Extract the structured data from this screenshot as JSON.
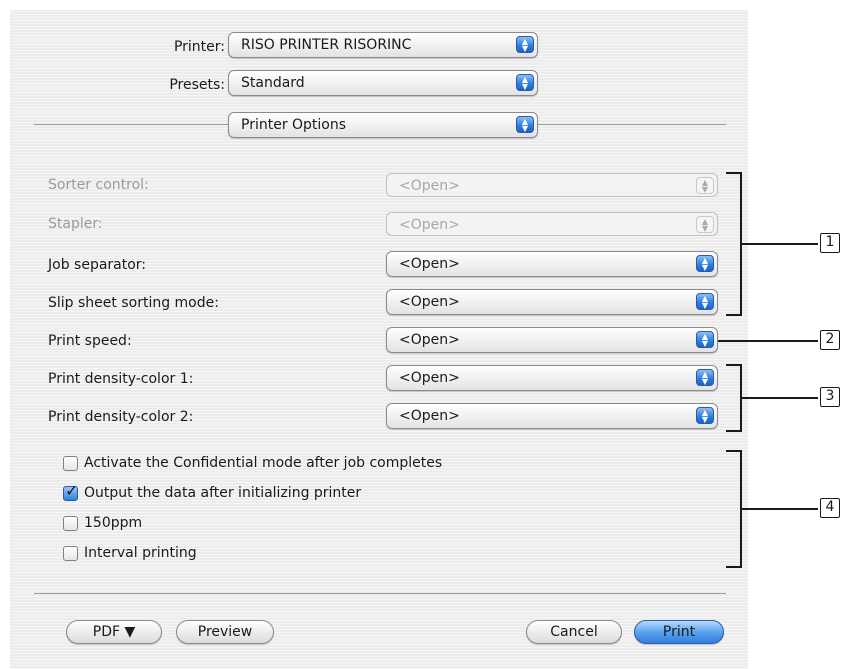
{
  "header": {
    "printer_label": "Printer:",
    "printer_value": "RISO PRINTER RISORINC",
    "presets_label": "Presets:",
    "presets_value": "Standard",
    "pane_value": "Printer Options"
  },
  "options": [
    {
      "label": "Sorter control:",
      "value": "<Open>",
      "enabled": false
    },
    {
      "label": "Stapler:",
      "value": "<Open>",
      "enabled": false
    },
    {
      "label": "Job separator:",
      "value": "<Open>",
      "enabled": true
    },
    {
      "label": "Slip sheet sorting mode:",
      "value": "<Open>",
      "enabled": true
    },
    {
      "label": "Print speed:",
      "value": "<Open>",
      "enabled": true
    },
    {
      "label": "Print density-color 1:",
      "value": "<Open>",
      "enabled": true
    },
    {
      "label": "Print density-color 2:",
      "value": "<Open>",
      "enabled": true
    }
  ],
  "checkboxes": [
    {
      "label": "Activate the Confidential mode after job completes",
      "checked": false
    },
    {
      "label": "Output the data after initializing printer",
      "checked": true
    },
    {
      "label": "150ppm",
      "checked": false
    },
    {
      "label": "Interval printing",
      "checked": false
    }
  ],
  "footer": {
    "pdf_label": "PDF ▼",
    "preview_label": "Preview",
    "cancel_label": "Cancel",
    "print_label": "Print"
  },
  "callouts": [
    "1",
    "2",
    "3",
    "4"
  ],
  "icons": {
    "popup_arrows": "up-down-arrows-icon",
    "checkmark": "checkmark-icon"
  },
  "colors": {
    "accent": "#2f7fe0",
    "disabled_text": "#9a9a9a"
  }
}
